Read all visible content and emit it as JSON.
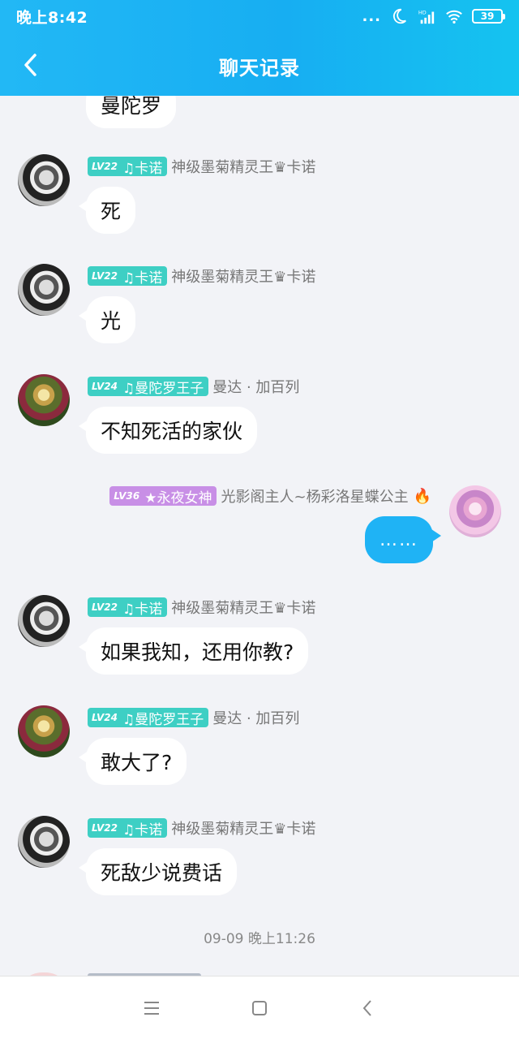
{
  "status_bar": {
    "time": "晚上8:42",
    "dots": "...",
    "signal_label": "HD",
    "battery": "39"
  },
  "nav": {
    "title": "聊天记录"
  },
  "messages": [
    {
      "badge": {
        "level": "LV22",
        "title": "♫卡诺"
      },
      "nickname": "神级墨菊精灵王♛卡诺",
      "text": "死"
    },
    {
      "badge": {
        "level": "LV22",
        "title": "♫卡诺"
      },
      "nickname": "神级墨菊精灵王♛卡诺",
      "text": "光"
    },
    {
      "badge": {
        "level": "LV24",
        "title": "♫曼陀罗王子"
      },
      "nickname": "曼达 · 加百列",
      "text": "不知死活的家伙"
    },
    {
      "badge": {
        "level": "LV36",
        "title": "★永夜女神"
      },
      "nickname": "光影阁主人~杨彩洛星蝶公主",
      "text": "……"
    },
    {
      "badge": {
        "level": "LV22",
        "title": "♫卡诺"
      },
      "nickname": "神级墨菊精灵王♛卡诺",
      "text": "如果我知，还用你教?"
    },
    {
      "badge": {
        "level": "LV24",
        "title": "♫曼陀罗王子"
      },
      "nickname": "曼达 · 加百列",
      "text": "敢大了?"
    },
    {
      "badge": {
        "level": "LV22",
        "title": "♫卡诺"
      },
      "nickname": "神级墨菊精灵王♛卡诺",
      "text": "死敌少说费话"
    }
  ],
  "partial_top_message": "曼陀罗",
  "timestamp": "09-09 晚上11:26",
  "colors": {
    "header": "#1fb3f5",
    "badge_teal": "#3ecfc4",
    "badge_purple": "#c88fe6",
    "my_bubble": "#1fb3f5"
  },
  "icons": [
    "back-arrow-icon",
    "moon-icon",
    "signal-icon",
    "wifi-icon",
    "battery-icon",
    "menu-icon",
    "home-square-icon",
    "back-triangle-icon",
    "fire-icon"
  ]
}
